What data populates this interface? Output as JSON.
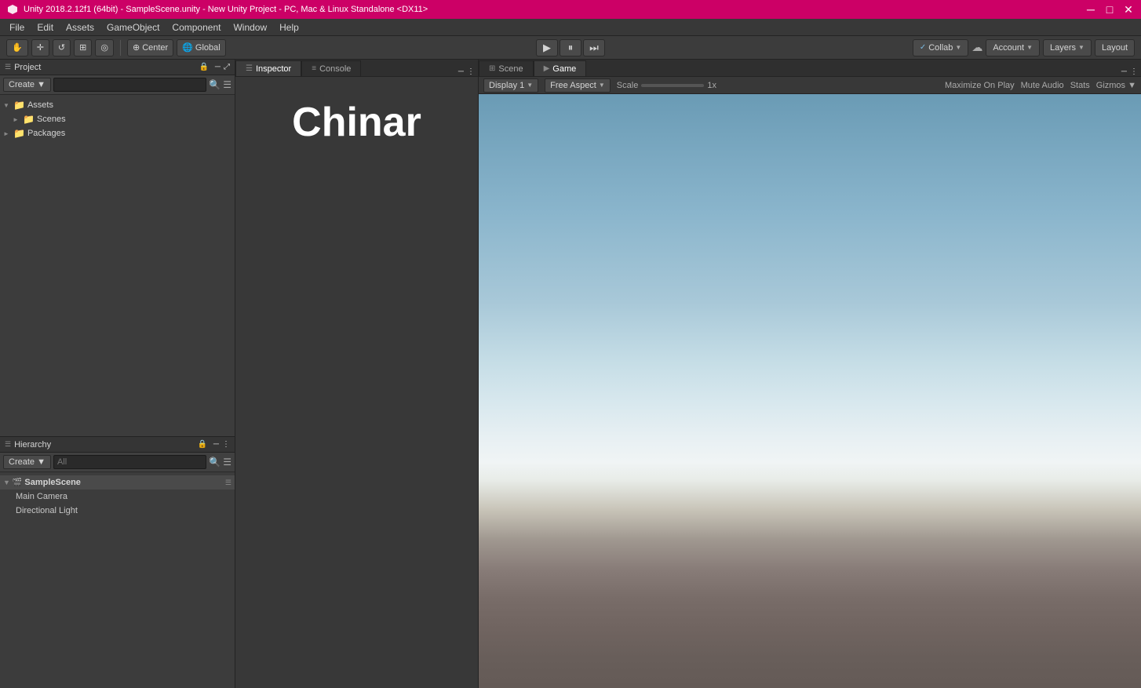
{
  "titleBar": {
    "title": "Unity 2018.2.12f1 (64bit) - SampleScene.unity - New Unity Project - PC, Mac & Linux Standalone <DX11>",
    "minimizeLabel": "─",
    "maximizeLabel": "□",
    "closeLabel": "✕"
  },
  "menuBar": {
    "items": [
      "File",
      "Edit",
      "Assets",
      "GameObject",
      "Component",
      "Window",
      "Help"
    ]
  },
  "toolbar": {
    "tools": [
      "☰",
      "↔",
      "↺",
      "⊞",
      "◎"
    ],
    "centerLabel": "Center",
    "globalLabel": "Global",
    "playLabel": "▶",
    "pauseLabel": "⏸",
    "stepLabel": "⏭",
    "collabLabel": "Collab",
    "cloudLabel": "☁",
    "accountLabel": "Account",
    "layersLabel": "Layers",
    "layoutLabel": "Layout"
  },
  "projectPanel": {
    "title": "Project",
    "createLabel": "Create ▼",
    "searchPlaceholder": "",
    "items": [
      {
        "label": "Assets",
        "indent": 0,
        "arrow": "▼",
        "icon": "📁"
      },
      {
        "label": "Scenes",
        "indent": 1,
        "arrow": "►",
        "icon": "📁"
      },
      {
        "label": "Packages",
        "indent": 0,
        "arrow": "►",
        "icon": "📁"
      }
    ]
  },
  "hierarchyPanel": {
    "title": "Hierarchy",
    "createLabel": "Create ▼",
    "searchPlaceholder": "All",
    "scene": {
      "name": "SampleScene",
      "items": [
        "Main Camera",
        "Directional Light"
      ]
    }
  },
  "inspectorPanel": {
    "tabs": [
      {
        "label": "Inspector",
        "icon": "☰",
        "active": true
      },
      {
        "label": "Console",
        "icon": "≡",
        "active": false
      }
    ],
    "chinarText": "Chinar"
  },
  "gamePanel": {
    "tabs": [
      {
        "label": "Scene",
        "icon": "⊞",
        "active": false
      },
      {
        "label": "Game",
        "icon": "▶",
        "active": true
      }
    ],
    "toolbar": {
      "display": "Display 1",
      "aspect": "Free Aspect",
      "scaleLabel": "Scale",
      "scaleValue": "1x",
      "maximizeLabel": "Maximize On Play",
      "muteLabel": "Mute Audio",
      "statsLabel": "Stats",
      "gizmosLabel": "Gizmos ▼"
    }
  }
}
